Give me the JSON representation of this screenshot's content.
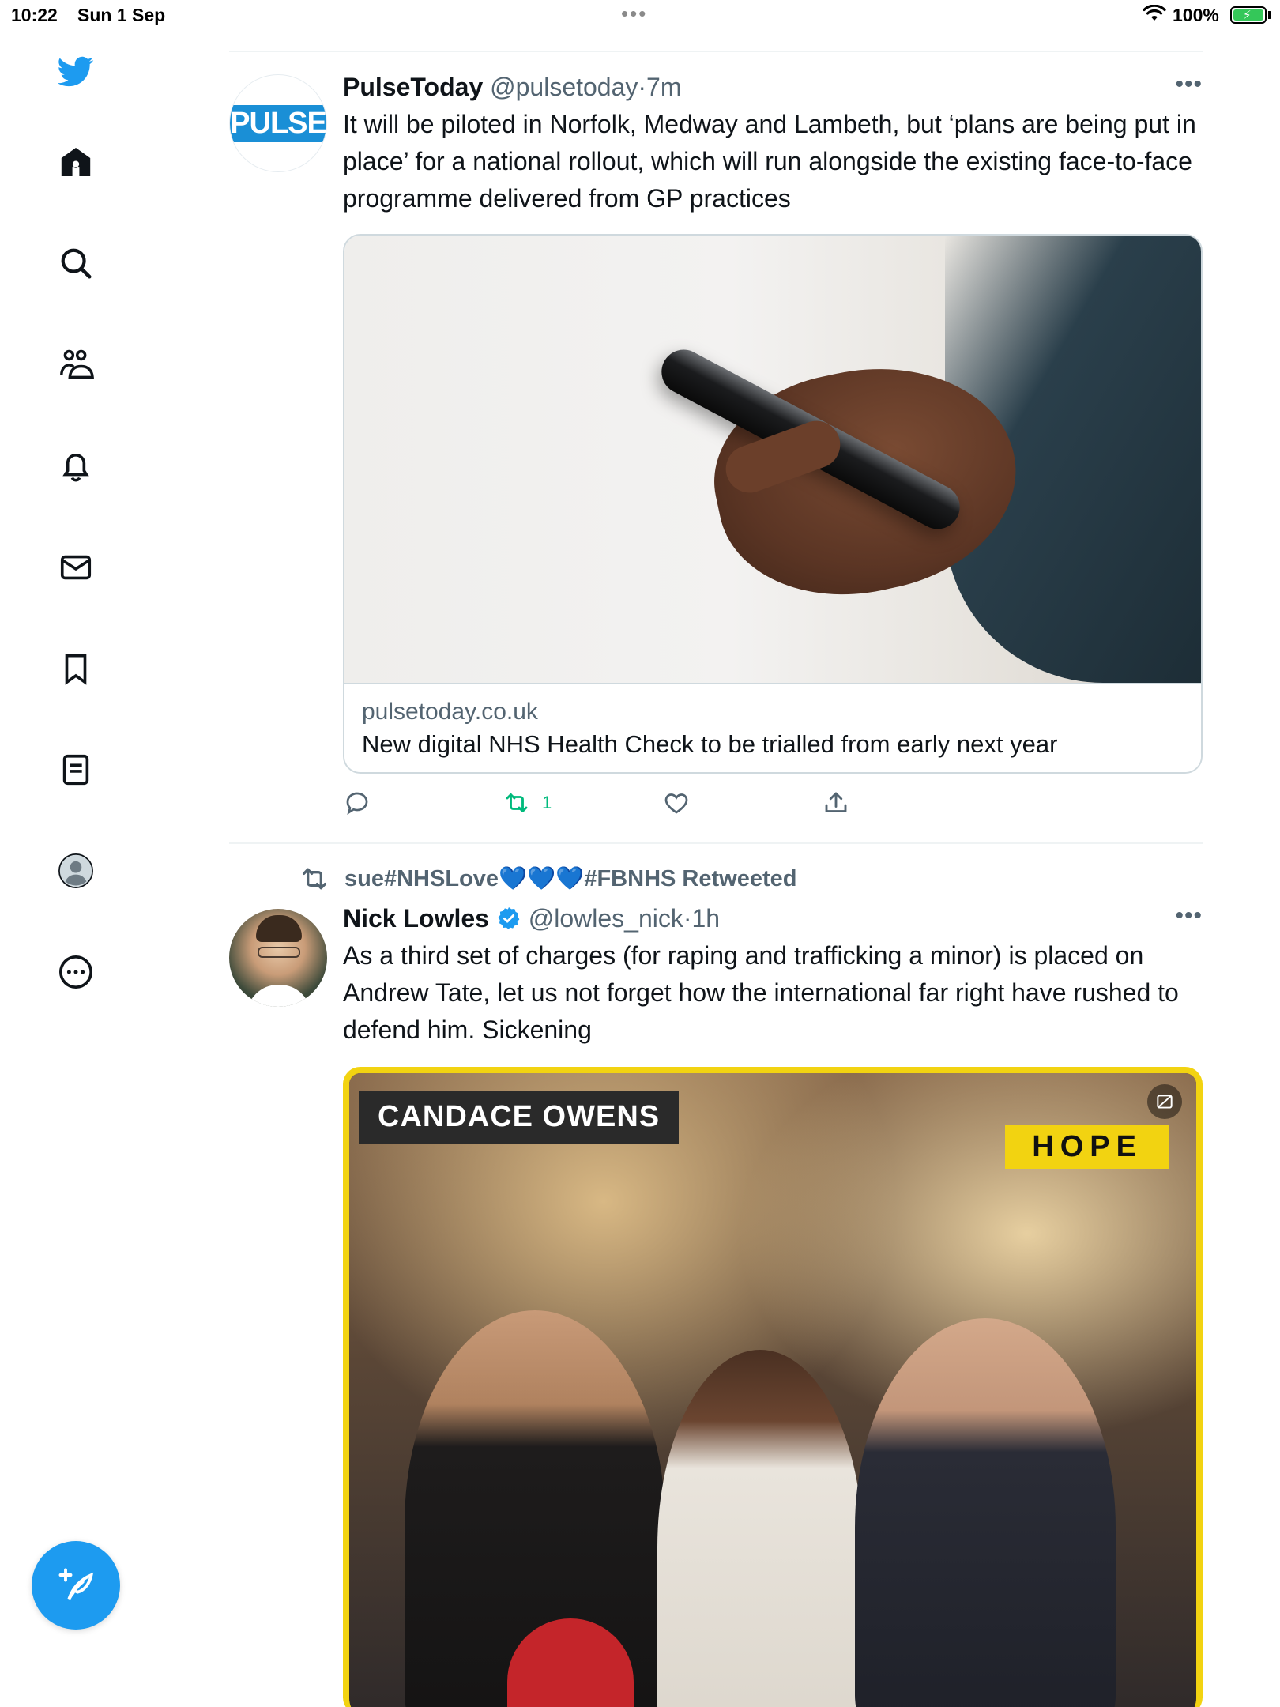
{
  "status_bar": {
    "time": "10:22",
    "date": "Sun 1 Sep",
    "center_indicator": "•••",
    "battery_percent": "100%",
    "battery_level": 1.0,
    "charging": true
  },
  "sidebar": {
    "items": [
      {
        "icon": "twitter-logo-icon"
      },
      {
        "icon": "home-icon"
      },
      {
        "icon": "search-icon"
      },
      {
        "icon": "communities-icon"
      },
      {
        "icon": "notifications-bell-icon"
      },
      {
        "icon": "messages-envelope-icon"
      },
      {
        "icon": "bookmark-icon"
      },
      {
        "icon": "lists-icon"
      },
      {
        "icon": "profile-icon"
      },
      {
        "icon": "more-options-icon"
      }
    ],
    "compose_icon": "compose-tweet-icon",
    "accent": "#1d9bf0"
  },
  "tweets": [
    {
      "name": "PulseToday",
      "handle": "@pulsetoday",
      "sep": "·",
      "time": "7m",
      "avatar_text": "PULSE",
      "avatar_color": "#1a8fd6",
      "text": "It will be piloted in Norfolk, Medway and Lambeth, but ‘plans are being put in place’ for a national rollout, which will run alongside the existing face-to-face programme delivered from GP practices",
      "card": {
        "domain": "pulsetoday.co.uk",
        "title": "New digital NHS Health Check to be trialled from early next year"
      },
      "actions": {
        "reply_count": "",
        "retweet_count": "1",
        "like_count": "",
        "retweet_active_color": "#00ba7c"
      }
    },
    {
      "retweeted_by": "sue#NHSLove💙💙💙#FBNHS Retweeted",
      "name": "Nick Lowles",
      "handle": "@lowles_nick",
      "sep": "·",
      "time": "1h",
      "verified": true,
      "text": "As a third set of charges (for raping and trafficking a minor) is placed on Andrew Tate, let us not forget how the international far right have rushed to defend him. Sickening",
      "media": {
        "caption_label": "CANDACE OWENS",
        "brand_label": "HOPE",
        "brand_color": "#f2d311"
      }
    }
  ]
}
